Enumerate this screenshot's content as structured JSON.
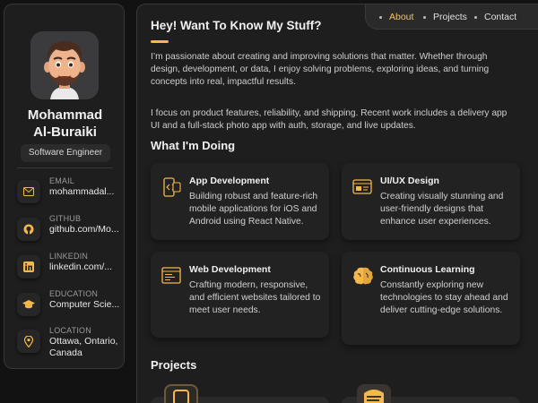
{
  "profile": {
    "name_line1": "Mohammad",
    "name_line2": "Al-Buraiki",
    "role": "Software Engineer"
  },
  "contacts": [
    {
      "icon": "mail-icon",
      "label": "EMAIL",
      "value": "mohammadal..."
    },
    {
      "icon": "github-icon",
      "label": "GITHUB",
      "value": "github.com/Mo..."
    },
    {
      "icon": "linkedin-icon",
      "label": "LINKEDIN",
      "value": "linkedin.com/..."
    },
    {
      "icon": "graduation-cap-icon",
      "label": "EDUCATION",
      "value": "Computer Scie..."
    },
    {
      "icon": "location-pin-icon",
      "label": "LOCATION",
      "value": "Ottawa, Ontario, Canada"
    }
  ],
  "nav": {
    "items": [
      "About",
      "Projects",
      "Contact"
    ],
    "active": "About"
  },
  "about": {
    "title": "Hey! Want To Know My Stuff?",
    "para1": "I’m passionate about creating and improving solutions that matter. Whether through design, development, or data, I enjoy solving problems, exploring ideas, and turning concepts into real, impactful results.",
    "para2": "I focus on product features, reliability, and shipping. Recent work includes a delivery app UI and a full-stack photo app with auth, storage, and live updates."
  },
  "doing": {
    "title": "What I'm Doing",
    "cards": [
      {
        "icon": "mobile-code-icon",
        "title": "App Development",
        "text": "Building robust and feature-rich mobile applications for iOS and Android using React Native."
      },
      {
        "icon": "ui-design-icon",
        "title": "UI/UX Design",
        "text": "Creating visually stunning and user-friendly designs that enhance user experiences."
      },
      {
        "icon": "web-code-icon",
        "title": "Web Development",
        "text": "Crafting modern, responsive, and efficient websites tailored to meet user needs."
      },
      {
        "icon": "brain-icon",
        "title": "Continuous Learning",
        "text": "Constantly exploring new technologies to stay ahead and deliver cutting-edge solutions."
      }
    ]
  },
  "projects": {
    "title": "Projects"
  },
  "colors": {
    "accent": "#f5b84a",
    "background": "#121212",
    "panel": "#1e1e1f",
    "card": "#222223"
  }
}
